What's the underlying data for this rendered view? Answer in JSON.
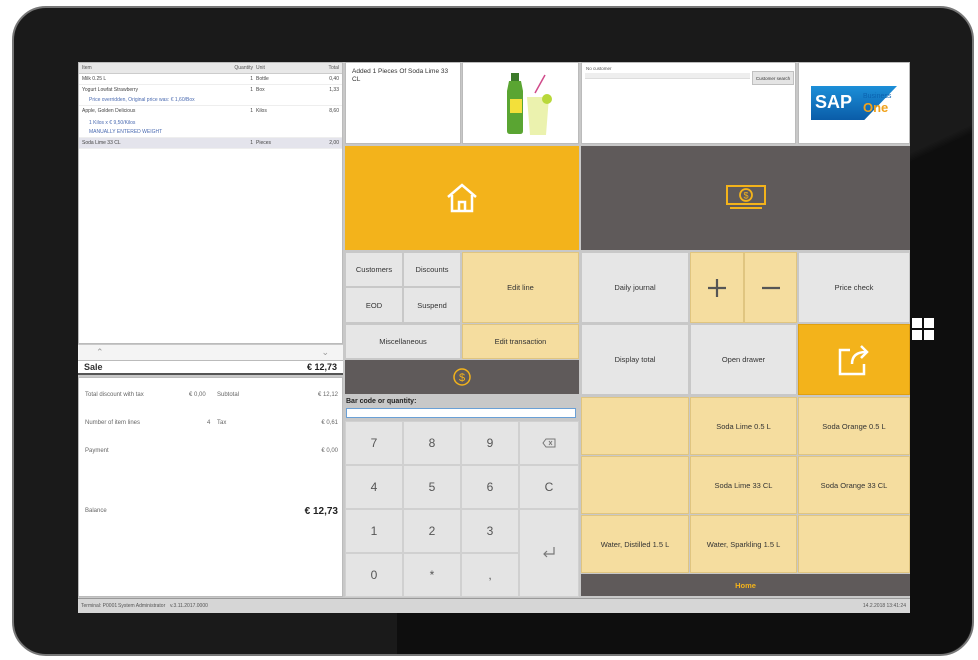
{
  "receipt": {
    "columns": [
      "Item",
      "Quantity",
      "Unit",
      "Total"
    ],
    "rows": [
      {
        "item": "Milk 0.25 L",
        "qty": "1",
        "unit": "Bottle",
        "total": "0,40"
      },
      {
        "item": "Yogurt Lowfat Strawberry",
        "qty": "1",
        "unit": "Box",
        "total": "1,33"
      },
      {
        "note": "Price overridden, Original price was: € 1,60/Box"
      },
      {
        "item": "Apple, Golden Delicious",
        "qty": "1",
        "unit": "Kilos",
        "total": "8,60"
      },
      {
        "note": "1 Kilos x € 9,50/Kilos"
      },
      {
        "note": "MANUALLY ENTERED WEIGHT"
      },
      {
        "item": "Soda Lime 33 CL",
        "qty": "1",
        "unit": "Pieces",
        "total": "2,00"
      }
    ]
  },
  "sale": {
    "label": "Sale",
    "amount": "€ 12,73"
  },
  "totals": {
    "discount_label": "Total discount with tax",
    "discount_value": "€ 0,00",
    "subtotal_label": "Subtotal",
    "subtotal_value": "€ 12,12",
    "item_lines_label": "Number of item lines",
    "item_lines_value": "4",
    "tax_label": "Tax",
    "tax_value": "€ 0,61",
    "payment_label": "Payment",
    "payment_value": "€ 0,00",
    "balance_label": "Balance",
    "balance_value": "€ 12,73"
  },
  "status_bar": {
    "terminal": "Terminal: P0001",
    "user": "System Administrator",
    "version": "v.3.11.2017.0000",
    "datetime": "14.2.2018 13:41:24"
  },
  "message": "Added 1 Pieces Of Soda Lime 33 CL",
  "customer": {
    "label": "No customer",
    "search_label": "Customer search"
  },
  "logo": {
    "sap": "SAP",
    "business": "Business",
    "one": "One"
  },
  "actions": {
    "customers": "Customers",
    "discounts": "Discounts",
    "edit_line": "Edit line",
    "eod": "EOD",
    "suspend": "Suspend",
    "miscellaneous": "Miscellaneous",
    "edit_transaction": "Edit transaction",
    "daily_journal": "Daily journal",
    "price_check": "Price check",
    "display_total": "Display total",
    "open_drawer": "Open drawer"
  },
  "barcode": {
    "label": "Bar code or quantity:"
  },
  "keypad": {
    "k7": "7",
    "k8": "8",
    "k9": "9",
    "k4": "4",
    "k5": "5",
    "k6": "6",
    "k1": "1",
    "k2": "2",
    "k3": "3",
    "k0": "0",
    "kstar": "*",
    "kcomma": ",",
    "clear": "C"
  },
  "products": {
    "p1": "Soda Lime 0.5 L",
    "p2": "Soda Orange 0.5 L",
    "p3": "Soda Lime 33 CL",
    "p4": "Soda Orange 33 CL",
    "p5": "Water, Distilled 1.5 L",
    "p6": "Water, Sparkling 1.5 L"
  },
  "footer": {
    "home": "Home"
  },
  "colors": {
    "accent": "#f3b31b",
    "cream": "#f5dd9f",
    "dark": "#5f5a5a",
    "light": "#e6e6e6"
  },
  "icons": [
    "home-icon",
    "cash-icon",
    "payment-icon",
    "backspace-icon",
    "enter-icon",
    "plus-icon",
    "minus-icon",
    "exit-icon",
    "windows-icon",
    "chevron-up-icon",
    "chevron-down-icon"
  ]
}
